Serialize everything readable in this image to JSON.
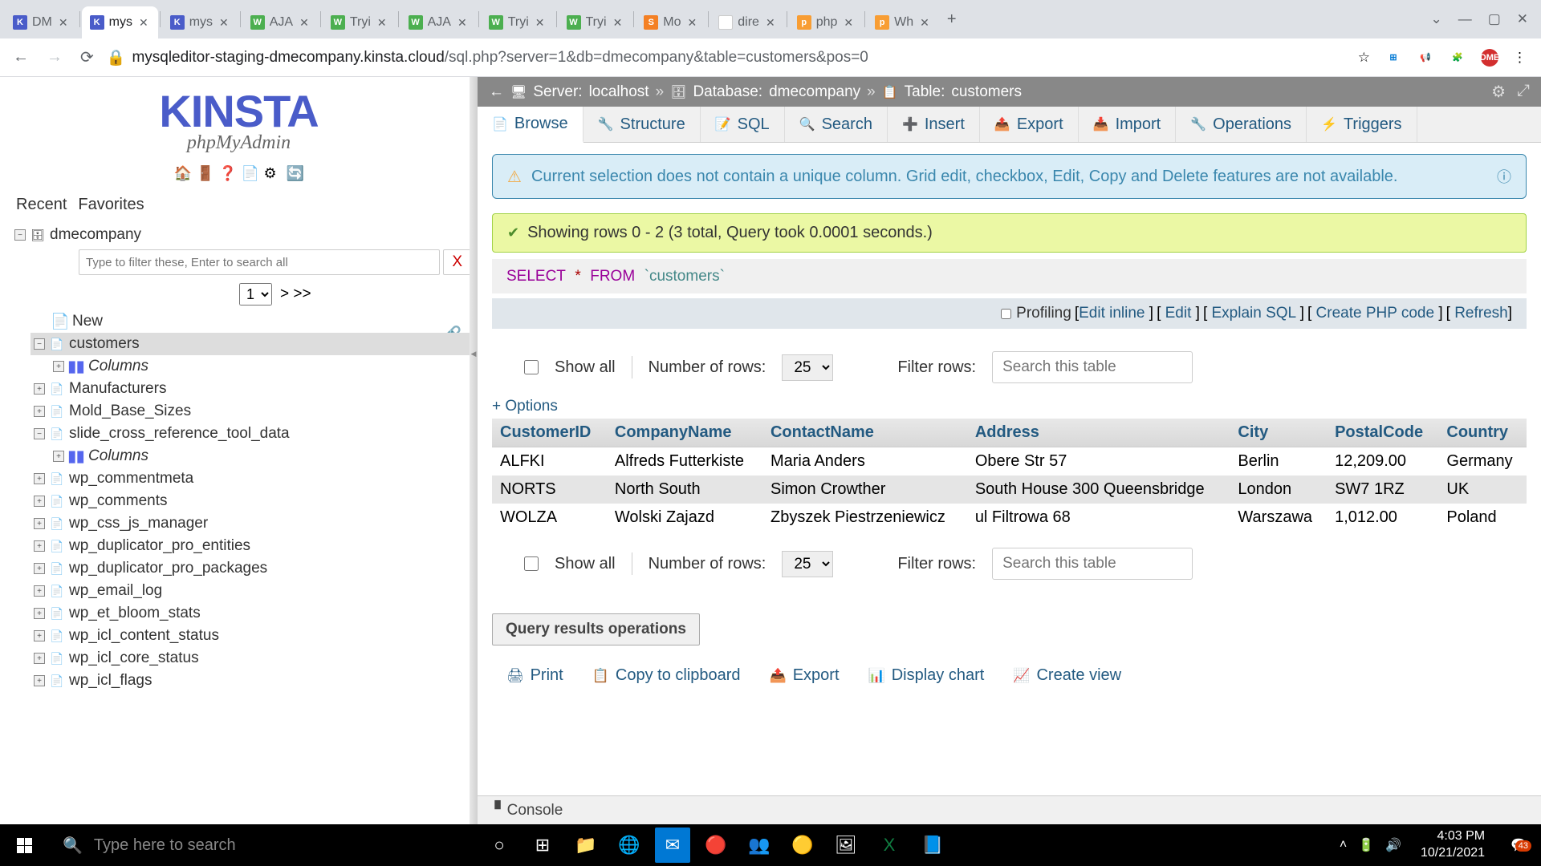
{
  "browser": {
    "tabs": [
      {
        "favicon": "K",
        "title": "DM"
      },
      {
        "favicon": "K",
        "title": "mys",
        "active": true
      },
      {
        "favicon": "K",
        "title": "mys"
      },
      {
        "favicon": "W",
        "title": "AJA",
        "cls": "w3"
      },
      {
        "favicon": "W",
        "title": "Tryi",
        "cls": "w3"
      },
      {
        "favicon": "W",
        "title": "AJA",
        "cls": "w3"
      },
      {
        "favicon": "W",
        "title": "Tryi",
        "cls": "w3"
      },
      {
        "favicon": "W",
        "title": "Tryi",
        "cls": "w3"
      },
      {
        "favicon": "S",
        "title": "Mo",
        "cls": "so"
      },
      {
        "favicon": "G",
        "title": "dire",
        "cls": "g"
      },
      {
        "favicon": "p",
        "title": "php",
        "cls": "pma"
      },
      {
        "favicon": "p",
        "title": "Wh",
        "cls": "pma"
      }
    ],
    "url_host": "mysqleditor-staging-dmecompany.kinsta.cloud",
    "url_path": "/sql.php?server=1&db=dmecompany&table=customers&pos=0"
  },
  "logo": {
    "brand": "KINSTA",
    "app": "phpMyAdmin"
  },
  "nav": {
    "recent": "Recent",
    "favorites": "Favorites"
  },
  "tree": {
    "db": "dmecompany",
    "filter_placeholder": "Type to filter these, Enter to search all",
    "filter_clear": "X",
    "page": "1",
    "page_next": "> >>",
    "new": "New",
    "columns_label": "Columns",
    "tables": [
      "customers",
      "Manufacturers",
      "Mold_Base_Sizes",
      "slide_cross_reference_tool_data",
      "wp_commentmeta",
      "wp_comments",
      "wp_css_js_manager",
      "wp_duplicator_pro_entities",
      "wp_duplicator_pro_packages",
      "wp_email_log",
      "wp_et_bloom_stats",
      "wp_icl_content_status",
      "wp_icl_core_status",
      "wp_icl_flags"
    ],
    "selected": "customers",
    "expanded_with_columns": [
      "customers",
      "slide_cross_reference_tool_data"
    ]
  },
  "breadcrumb": {
    "server_label": "Server:",
    "server": "localhost",
    "db_label": "Database:",
    "db": "dmecompany",
    "table_label": "Table:",
    "table": "customers"
  },
  "tabs": [
    {
      "icon": "📄",
      "label": "Browse",
      "active": true
    },
    {
      "icon": "🔧",
      "label": "Structure"
    },
    {
      "icon": "📝",
      "label": "SQL"
    },
    {
      "icon": "🔍",
      "label": "Search"
    },
    {
      "icon": "➕",
      "label": "Insert"
    },
    {
      "icon": "📤",
      "label": "Export"
    },
    {
      "icon": "📥",
      "label": "Import"
    },
    {
      "icon": "🔧",
      "label": "Operations"
    },
    {
      "icon": "⚡",
      "label": "Triggers"
    }
  ],
  "notice": "Current selection does not contain a unique column. Grid edit, checkbox, Edit, Copy and Delete features are not available.",
  "success": "Showing rows 0 - 2 (3 total, Query took 0.0001 seconds.)",
  "sql": {
    "select": "SELECT",
    "star": "*",
    "from": "FROM",
    "table": "`customers`"
  },
  "sql_links": {
    "profiling": "Profiling",
    "edit_inline": "Edit inline",
    "edit": "Edit",
    "explain": "Explain SQL",
    "php": "Create PHP code",
    "refresh": "Refresh"
  },
  "row_ctrl": {
    "show_all": "Show all",
    "num_rows_lbl": "Number of rows:",
    "num_rows": "25",
    "filter_lbl": "Filter rows:",
    "filter_placeholder": "Search this table"
  },
  "options": "+ Options",
  "columns": [
    "CustomerID",
    "CompanyName",
    "ContactName",
    "Address",
    "City",
    "PostalCode",
    "Country"
  ],
  "rows": [
    {
      "CustomerID": "ALFKI",
      "CompanyName": "Alfreds Futterkiste",
      "ContactName": "Maria Anders",
      "Address": "Obere Str 57",
      "City": "Berlin",
      "PostalCode": "12,209.00",
      "Country": "Germany"
    },
    {
      "CustomerID": "NORTS",
      "CompanyName": "North South",
      "ContactName": "Simon Crowther",
      "Address": "South House 300 Queensbridge",
      "City": "London",
      "PostalCode": "SW7 1RZ",
      "Country": "UK"
    },
    {
      "CustomerID": "WOLZA",
      "CompanyName": "Wolski Zajazd",
      "ContactName": "Zbyszek Piestrzeniewicz",
      "Address": "ul Filtrowa 68",
      "City": "Warszawa",
      "PostalCode": "1,012.00",
      "Country": "Poland"
    }
  ],
  "results_legend": "Query results operations",
  "results_ops": [
    {
      "icon": "🖨",
      "label": "Print"
    },
    {
      "icon": "📋",
      "label": "Copy to clipboard"
    },
    {
      "icon": "📤",
      "label": "Export"
    },
    {
      "icon": "📊",
      "label": "Display chart"
    },
    {
      "icon": "📈",
      "label": "Create view"
    }
  ],
  "console": "Console",
  "taskbar": {
    "search_placeholder": "Type here to search",
    "time": "4:03 PM",
    "date": "10/21/2021",
    "notif": "43"
  }
}
